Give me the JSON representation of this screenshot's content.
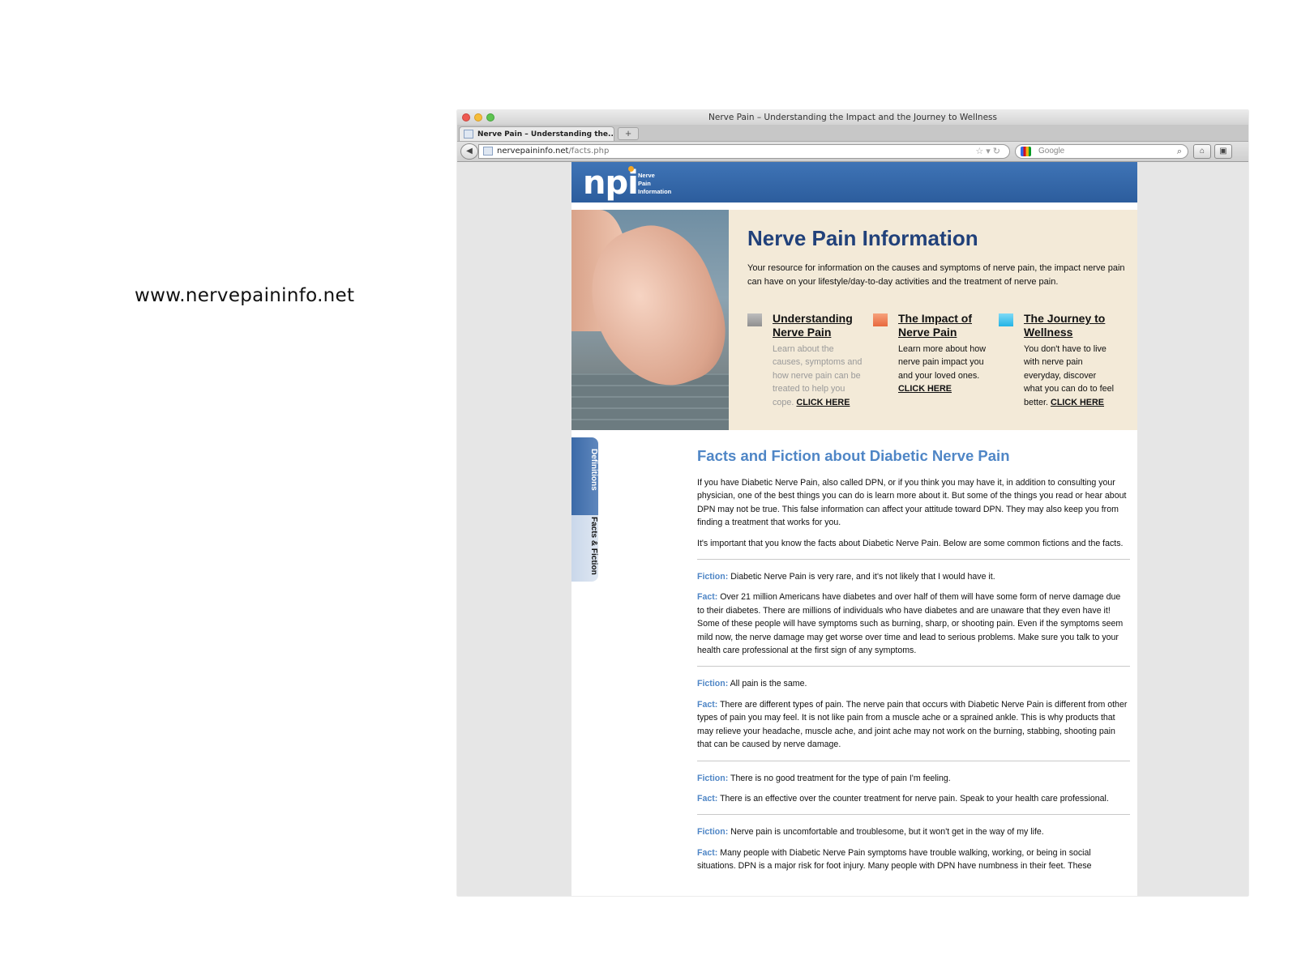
{
  "slide": {
    "caption": "www.nervepaininfo.net"
  },
  "browser": {
    "window_title": "Nerve Pain – Understanding the Impact and the Journey to Wellness",
    "tab_label": "Nerve Pain – Understanding the...",
    "new_tab": "+",
    "url_domain": "nervepaininfo.net",
    "url_path": "/facts.php",
    "search_placeholder": "Google"
  },
  "site": {
    "logo": "npi",
    "logo_sub": [
      "Nerve",
      "Pain",
      "Information"
    ],
    "hero": {
      "title": "Nerve Pain Information",
      "description": "Your resource for information on the causes and symptoms of nerve pain, the impact nerve pain can have on your lifestyle/day-to-day activities and the treatment of nerve pain.",
      "columns": [
        {
          "title": "Understanding Nerve Pain",
          "text": "Learn about the causes, symptoms and how nerve pain can be treated to help you cope.",
          "link": "CLICK HERE",
          "color": "#9e9e9e"
        },
        {
          "title": "The Impact of Nerve Pain",
          "text": "Learn more about how nerve pain impact you and your loved ones.",
          "link": "CLICK HERE",
          "color": "#f08a5d"
        },
        {
          "title": "The Journey to Wellness",
          "text": "You don't have to live with nerve pain everyday, discover what you can do to feel better.",
          "link": "CLICK HERE",
          "color": "#3fc3ee"
        }
      ]
    },
    "side_tabs": {
      "definitions": "Definitions",
      "facts": "Facts & Fiction"
    },
    "content": {
      "title": "Facts and Fiction about Diabetic Nerve Pain",
      "intro1": "If you have Diabetic Nerve Pain, also called DPN, or if you think you may have it, in addition to consulting your physician, one of the best things you can do is learn more about it. But some of the things you read or hear about DPN may not be true. This false information can affect your attitude toward DPN. They may also keep you from finding a treatment that works for you.",
      "intro2": "It's important that you know the facts about Diabetic Nerve Pain. Below are some common fictions and the facts.",
      "fiction_label": "Fiction:",
      "fact_label": "Fact:",
      "items": [
        {
          "fiction": "Diabetic Nerve Pain is very rare, and it's not likely that I would have it.",
          "fact": "Over 21 million Americans have diabetes and over half of them will have some form of nerve damage due to their diabetes. There are millions of individuals who have diabetes and are unaware that they even have it! Some of these people will have symptoms such as burning, sharp, or shooting pain. Even if the symptoms seem mild now, the nerve damage may get worse over time and lead to serious problems. Make sure you talk to your health care professional at the first sign of any symptoms."
        },
        {
          "fiction": "All pain is the same.",
          "fact": "There are different types of pain. The nerve pain that occurs with Diabetic Nerve Pain is different from other types of pain you may feel. It is not like pain from a muscle ache or a sprained ankle. This is why products that may relieve your headache, muscle ache, and joint ache may not work on the burning, stabbing, shooting pain that can be caused by nerve damage."
        },
        {
          "fiction": "There is no good treatment for the type of pain I'm feeling.",
          "fact": "There is an effective over the counter treatment for nerve pain. Speak to your health care professional."
        },
        {
          "fiction": "Nerve pain is uncomfortable and troublesome, but it won't get in the way of my life.",
          "fact": "Many people with Diabetic Nerve Pain symptoms have trouble walking, working, or being in social situations. DPN is a major risk for foot injury. Many people with DPN have numbness in their feet. These"
        }
      ]
    }
  }
}
